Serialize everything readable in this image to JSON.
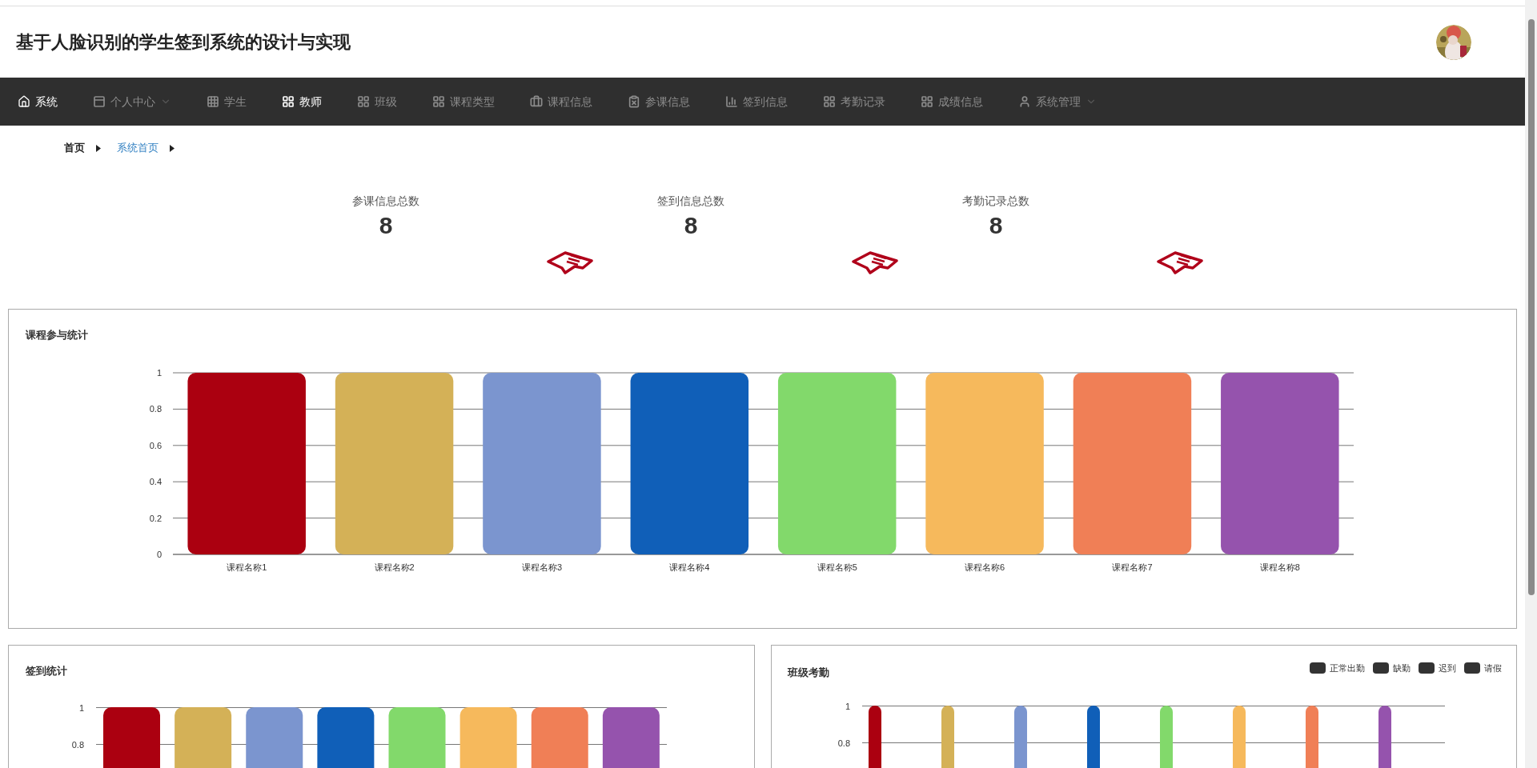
{
  "header": {
    "title": "基于人脸识别的学生签到系统的设计与实现"
  },
  "nav": [
    {
      "label": "系统",
      "kind": "home",
      "selected": true
    },
    {
      "label": "个人中心",
      "kind": "dropdown",
      "selected": false
    },
    {
      "label": "学生",
      "kind": "link",
      "selected": false
    },
    {
      "label": "教师",
      "kind": "link",
      "selected": true
    },
    {
      "label": "班级",
      "kind": "link",
      "selected": false
    },
    {
      "label": "课程类型",
      "kind": "link",
      "selected": false
    },
    {
      "label": "课程信息",
      "kind": "link",
      "selected": false
    },
    {
      "label": "参课信息",
      "kind": "link",
      "selected": false
    },
    {
      "label": "签到信息",
      "kind": "link",
      "selected": false
    },
    {
      "label": "考勤记录",
      "kind": "link",
      "selected": false
    },
    {
      "label": "成绩信息",
      "kind": "link",
      "selected": false
    },
    {
      "label": "系统管理",
      "kind": "dropdown",
      "selected": false
    }
  ],
  "breadcrumb": [
    {
      "label": "首页",
      "selected": false
    },
    {
      "label": "系统首页",
      "selected": true
    }
  ],
  "stats": [
    {
      "label": "参课信息总数",
      "value": "8"
    },
    {
      "label": "签到信息总数",
      "value": "8"
    },
    {
      "label": "考勤记录总数",
      "value": "8"
    }
  ],
  "course_chart": {
    "title": "课程参与统计",
    "chart_data": {
      "type": "bar",
      "categories": [
        "课程名称1",
        "课程名称2",
        "课程名称3",
        "课程名称4",
        "课程名称5",
        "课程名称6",
        "课程名称7",
        "课程名称8"
      ],
      "values": [
        1,
        1,
        1,
        1,
        1,
        1,
        1,
        1
      ],
      "colors": [
        "#ab0010",
        "#d4b157",
        "#7b95cf",
        "#105fb8",
        "#82d96b",
        "#f6b95c",
        "#f07f56",
        "#9553ad"
      ],
      "ylim": [
        0,
        1
      ],
      "yticks": [
        0,
        0.2,
        0.4,
        0.6,
        0.8,
        1
      ],
      "grid": true
    }
  },
  "signin_chart": {
    "title": "签到统计",
    "y_tick_labels": [
      "1",
      "0.8"
    ]
  },
  "class_chart": {
    "title": "班级考勤",
    "legend": [
      "正常出勤",
      "缺勤",
      "迟到",
      "请假"
    ],
    "y_tick_labels": [
      "1",
      "0.8"
    ]
  }
}
